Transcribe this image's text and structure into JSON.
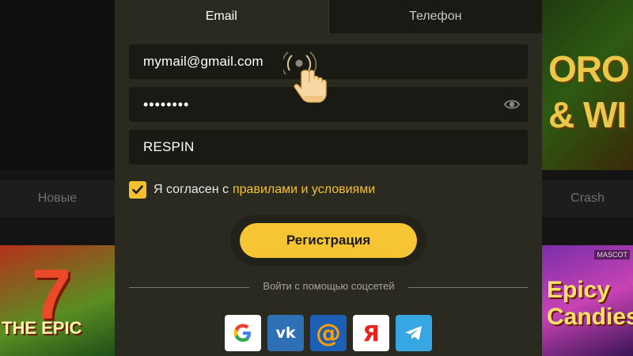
{
  "background": {
    "banner_text": "ORO\n& WI",
    "categories_left": "Новые",
    "categories_right": "Crash",
    "game_left_title": "THE EPIC",
    "game_right_title": "Epicy\nCandies",
    "mascot_badge": "MASCOT"
  },
  "tabs": [
    {
      "label": "Email",
      "active": true
    },
    {
      "label": "Телефон",
      "active": false
    }
  ],
  "form": {
    "email_value": "mymail@gmail.com",
    "password_value": "••••••••",
    "promo_value": "RESPIN",
    "agree_text": "Я согласен с",
    "agree_link": "правилами и условиями",
    "agree_checked": true,
    "register_label": "Регистрация"
  },
  "social": {
    "label": "Войти с помощью соцсетей",
    "providers": [
      {
        "name": "Google",
        "icon": "google-icon",
        "glyph": "G"
      },
      {
        "name": "VK",
        "icon": "vk-icon",
        "glyph": "vk"
      },
      {
        "name": "Mail.ru",
        "icon": "mail-at-icon",
        "glyph": "@"
      },
      {
        "name": "Yandex",
        "icon": "yandex-icon",
        "glyph": "Я"
      },
      {
        "name": "Telegram",
        "icon": "telegram-icon",
        "glyph": ""
      }
    ]
  },
  "colors": {
    "accent": "#f7c433",
    "modal_bg": "#2b2a20",
    "field_bg": "#1a1a15"
  }
}
